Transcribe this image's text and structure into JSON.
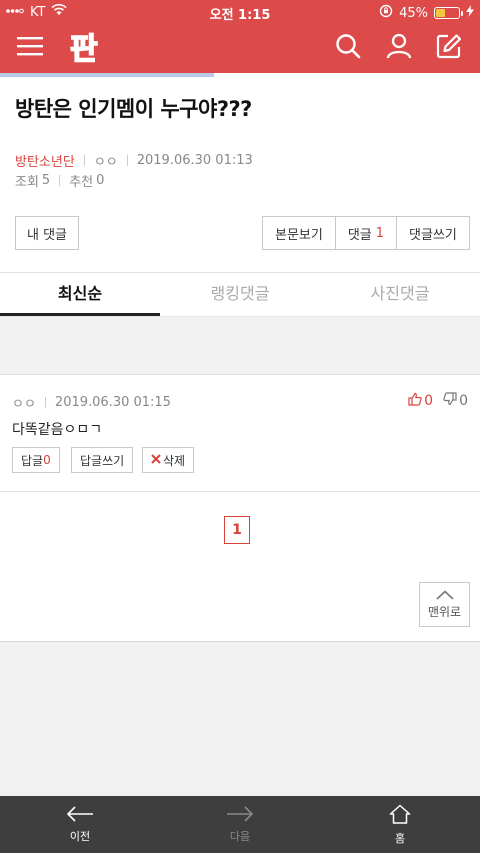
{
  "status": {
    "carrier": "KT",
    "time": "오전 1:15",
    "battery": "45%",
    "battery_level": 0.45
  },
  "header": {
    "logo_text": "판",
    "icons": [
      "menu-icon",
      "search-icon",
      "user-icon",
      "edit-icon"
    ]
  },
  "article": {
    "title": "방탄은 인기멤이 누구야???",
    "category": "방탄소년단",
    "author": "ㅇㅇ",
    "date": "2019.06.30 01:13",
    "views_label": "조회",
    "views": "5",
    "recommend_label": "추천",
    "recommend": "0"
  },
  "actions": {
    "my_comments": "내 댓글",
    "view_post": "본문보기",
    "comments_label": "댓글",
    "comments_count": "1",
    "write_comment": "댓글쓰기"
  },
  "tabs": [
    "최신순",
    "랭킹댓글",
    "사진댓글"
  ],
  "comment": {
    "author": "ㅇㅇ",
    "date": "2019.06.30 01:15",
    "likes": "0",
    "dislikes": "0",
    "body": "다똑같음ㅇㅁㄱ",
    "reply_label": "답글",
    "reply_count": "0",
    "write_reply": "답글쓰기",
    "delete": "삭제"
  },
  "pager": {
    "current": "1"
  },
  "to_top": "맨위로",
  "bottom_nav": {
    "prev": "이전",
    "next": "다음",
    "home": "홈"
  },
  "colors": {
    "brand": "#dd4a4a",
    "accent_red": "#d9433b",
    "bottom_bar": "#3e3e3e"
  }
}
